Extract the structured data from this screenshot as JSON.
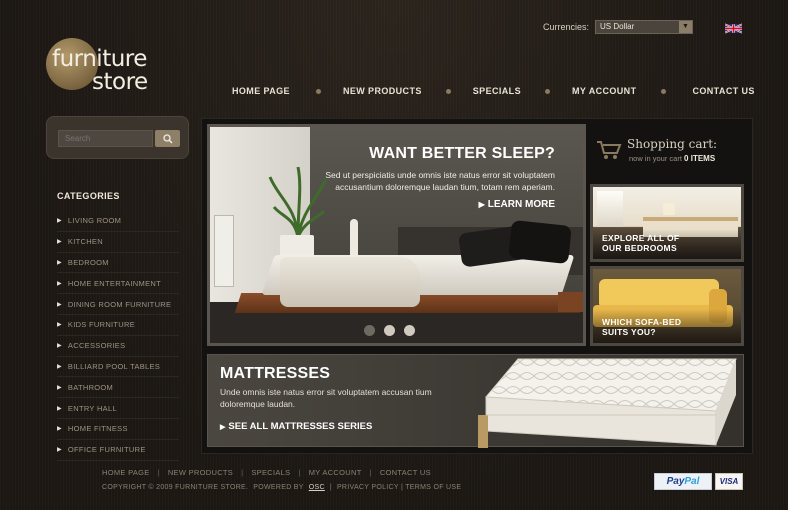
{
  "logo": {
    "line1": "furniture",
    "line2": "store"
  },
  "currency": {
    "label": "Currencies:",
    "selected": "US Dollar",
    "flag_icon": "uk-flag-icon"
  },
  "nav": [
    {
      "label": "HOME PAGE"
    },
    {
      "label": "NEW PRODUCTS"
    },
    {
      "label": "SPECIALS"
    },
    {
      "label": "MY ACCOUNT"
    },
    {
      "label": "CONTACT US"
    }
  ],
  "search": {
    "placeholder": "Search",
    "button_icon": "magnifier-icon"
  },
  "categories": {
    "title": "CATEGORIES",
    "items": [
      "LIVING ROOM",
      "KITCHEN",
      "BEDROOM",
      "HOME ENTERTAINMENT",
      "DINING ROOM FURNITURE",
      "KIDS FURNITURE",
      "ACCESSORIES",
      "BILLIARD POOL TABLES",
      "BATHROOM",
      "ENTRY HALL",
      "HOME FITNESS",
      "OFFICE FURNITURE"
    ]
  },
  "hero": {
    "title": "WANT BETTER SLEEP?",
    "text": "Sed ut perspiciatis unde omnis iste natus error sit voluptatem accusantium doloremque laudan tium, totam rem aperiam.",
    "more": "LEARN MORE",
    "slides": 3,
    "active_slide": 1
  },
  "cart": {
    "title": "Shopping cart:",
    "status": "now in your cart",
    "count": "0 ITEMS"
  },
  "promos": [
    {
      "line1": "EXPLORE ALL OF",
      "line2": "OUR BEDROOMS"
    },
    {
      "line1": "WHICH SOFA-BED",
      "line2": "SUITS YOU?"
    }
  ],
  "mattress": {
    "title": "MATTRESSES",
    "text": "Unde omnis iste natus error sit voluptatem accusan tium doloremque laudan.",
    "link": "SEE ALL MATTRESSES SERIES"
  },
  "footer": {
    "links": [
      "HOME PAGE",
      "NEW PRODUCTS",
      "SPECIALS",
      "MY ACCOUNT",
      "CONTACT US"
    ],
    "copyright": "COPYRIGHT © 2009 FURNITURE STORE.",
    "powered": "POWERED BY",
    "osc": "OSC",
    "privacy": "PRIVACY POLICY | TERMS OF USE",
    "paypal_a": "Pay",
    "paypal_b": "Pal",
    "visa": "VISA"
  }
}
